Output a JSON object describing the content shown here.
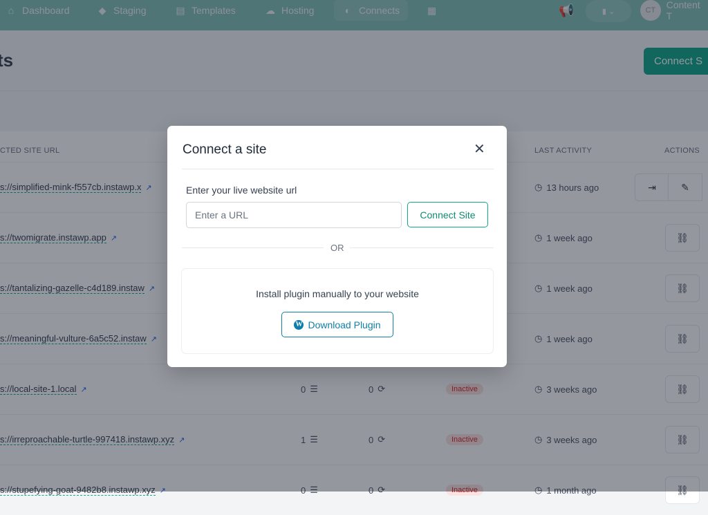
{
  "nav": {
    "items": [
      {
        "label": "Dashboard",
        "icon": "home-icon"
      },
      {
        "label": "Staging",
        "icon": "cube-icon"
      },
      {
        "label": "Templates",
        "icon": "template-icon"
      },
      {
        "label": "Hosting",
        "icon": "cloud-server-icon"
      },
      {
        "label": "Connects",
        "icon": "connect-icon",
        "active": true
      }
    ],
    "user": {
      "initials": "CT",
      "name": "Content T"
    }
  },
  "page": {
    "title": "ts",
    "connect_button": "Connect S"
  },
  "table": {
    "headers": {
      "url": "CTED SITE URL",
      "last_activity": "LAST ACTIVITY",
      "actions": "ACTIONS"
    },
    "rows": [
      {
        "url": "s://simplified-mink-f557cb.instawp.x",
        "pages": "",
        "syncs": "",
        "status": "",
        "last": "13 hours ago"
      },
      {
        "url": "s://twomigrate.instawp.app",
        "pages": "",
        "syncs": "",
        "status": "",
        "last": "1 week ago"
      },
      {
        "url": "s://tantalizing-gazelle-c4d189.instaw",
        "pages": "",
        "syncs": "",
        "status": "",
        "last": "1 week ago"
      },
      {
        "url": "s://meaningful-vulture-6a5c52.instaw",
        "pages": "",
        "syncs": "",
        "status": "",
        "last": "1 week ago"
      },
      {
        "url": "s://local-site-1.local",
        "pages": "0",
        "syncs": "0",
        "status": "Inactive",
        "last": "3 weeks ago"
      },
      {
        "url": "s://irreproachable-turtle-997418.instawp.xyz",
        "pages": "1",
        "syncs": "0",
        "status": "Inactive",
        "last": "3 weeks ago"
      },
      {
        "url": "s://stupefying-goat-9482b8.instawp.xyz",
        "pages": "0",
        "syncs": "0",
        "status": "Inactive",
        "last": "1 month ago"
      }
    ]
  },
  "modal": {
    "title": "Connect a site",
    "label": "Enter your live website url",
    "placeholder": "Enter a URL",
    "connect": "Connect Site",
    "or": "OR",
    "plugin_text": "Install plugin manually to your website",
    "download": "Download Plugin"
  },
  "colors": {
    "accent": "#11a889",
    "link": "#0e7fa8",
    "inactive": "#dc2626"
  }
}
